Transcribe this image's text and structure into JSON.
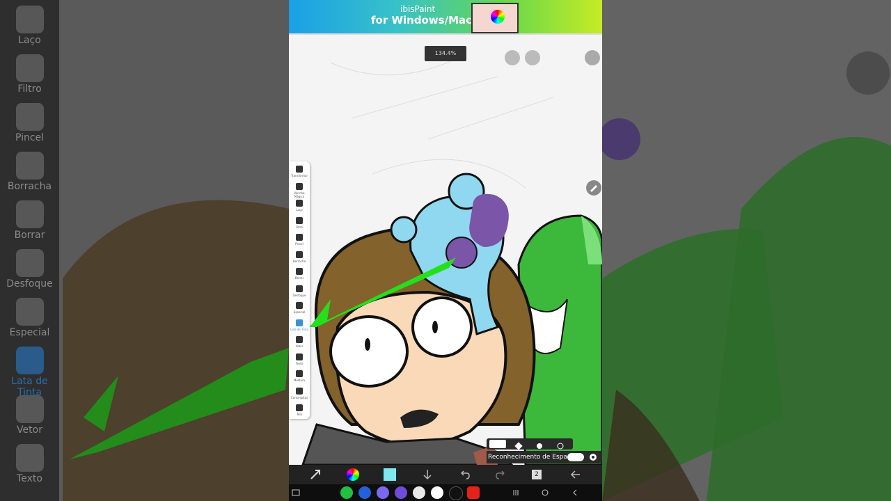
{
  "background_tools": [
    {
      "label": "Laço",
      "icon": "lasso-icon"
    },
    {
      "label": "Filtro",
      "icon": "fx-icon"
    },
    {
      "label": "Pincel",
      "icon": "brush-icon"
    },
    {
      "label": "Borracha",
      "icon": "eraser-icon"
    },
    {
      "label": "Borrar",
      "icon": "smudge-icon"
    },
    {
      "label": "Desfoque",
      "icon": "blur-icon"
    },
    {
      "label": "Especial",
      "icon": "special-wand-icon"
    },
    {
      "label": "Lata de Tinta",
      "icon": "paint-bucket-icon"
    },
    {
      "label": "Vetor",
      "icon": "vector-cursor-icon"
    },
    {
      "label": "Texto",
      "icon": "text-icon"
    }
  ],
  "ad": {
    "brand": "ibisPaint",
    "tagline": "for Windows/Mac"
  },
  "canvas": {
    "zoom_label": "134.4%"
  },
  "tools": [
    {
      "label": "Transformar",
      "icon": "move-icon"
    },
    {
      "label": "Varinha Mágica",
      "icon": "magic-wand-icon"
    },
    {
      "label": "Laço",
      "icon": "lasso-icon"
    },
    {
      "label": "Filtro",
      "icon": "fx-icon"
    },
    {
      "label": "Pincel",
      "icon": "brush-icon"
    },
    {
      "label": "Borracha",
      "icon": "eraser-icon"
    },
    {
      "label": "Borrar",
      "icon": "smudge-icon"
    },
    {
      "label": "Desfoque",
      "icon": "blur-icon"
    },
    {
      "label": "Especial",
      "icon": "special-wand-icon"
    },
    {
      "label": "Lata de Tinta",
      "icon": "paint-bucket-icon"
    },
    {
      "label": "Vetor",
      "icon": "vector-cursor-icon"
    },
    {
      "label": "Texto",
      "icon": "text-icon"
    },
    {
      "label": "Moldura",
      "icon": "frame-icon"
    },
    {
      "label": "Conta-gotas",
      "icon": "eyedropper-icon"
    },
    {
      "label": "Tela",
      "icon": "canvas-icon"
    }
  ],
  "brush_modes": [
    "fill-mode-icon",
    "eraser-mode-icon",
    "gap-mode-icon",
    "spread-mode-icon"
  ],
  "space_recognition": {
    "label": "Reconhecimento de Espaços",
    "enabled": true
  },
  "bottom_toolbar": [
    {
      "icon": "transform-tool-icon"
    },
    {
      "icon": "color-wheel-icon"
    },
    {
      "icon": "current-color-swatch",
      "color": "#7ee8f0"
    },
    {
      "icon": "download-arrow-icon"
    },
    {
      "icon": "undo-icon"
    },
    {
      "icon": "redo-icon"
    },
    {
      "icon": "layers-icon",
      "value": "2"
    },
    {
      "icon": "back-arrow-icon"
    }
  ],
  "nav_bar": [
    "keyboard-icon",
    "phone-app-icon",
    "messages-app-icon",
    "apps-grid-icon",
    "browser-app-icon",
    "camera-app-icon",
    "play-store-icon",
    "tiktok-icon",
    "youtube-icon",
    "recents-icon",
    "home-icon",
    "back-icon"
  ],
  "colors": {
    "ui_dark": "#222222",
    "accent_green": "#24e01b",
    "fill_blue": "#3d8fd6"
  }
}
